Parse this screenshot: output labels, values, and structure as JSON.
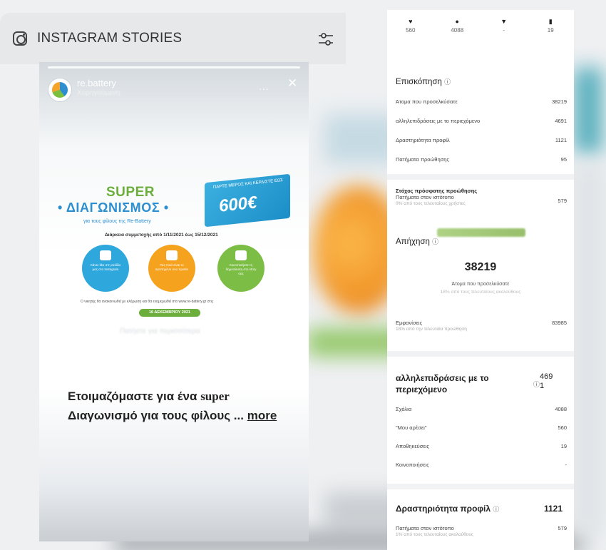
{
  "header": {
    "title": "INSTAGRAM STORIES"
  },
  "story": {
    "account_name": "re.battery",
    "account_sub": "Χορηγούμενη",
    "menu_dots": "...",
    "close": "✕",
    "promo": {
      "super": "SUPER",
      "title": "• ΔΙΑΓΩΝΙΣΜΟΣ •",
      "subtitle": "για τους φίλους της Re-Battery",
      "banner_top": "ΠΑΡΤΕ ΜΕΡΟΣ ΚΑΙ ΚΕΡΔΙΣΤΕ ΕΩΣ",
      "banner_amount": "600€",
      "dates": "Διάρκεια συμμετοχής από 1/11/2021 έως 15/12/2021",
      "step1": "Κάντε like στη σελίδα μας στο Instagram",
      "step2": "Πες ποιό είναι το αγαπημένο σου προϊόν",
      "step3": "Κοινοποιήστε τη δημοσίευση στο story σας",
      "fineprint": "Ο νικητής θα ανακοινωθεί με κλήρωση και θα ενημερωθεί στο www.re-battery.gr στις",
      "draw_date": "16 ΔΕΚΕΜΒΡΙΟΥ 2021",
      "faded_link": "Πατήστε για περισσότερα"
    },
    "caption_main": "Ετοιμαζόμαστε για ένα ",
    "caption_bold": "super",
    "caption_rest": " Διαγωνισμό για τους φίλους ... ",
    "caption_more": "more"
  },
  "insights": {
    "stats": [
      {
        "icon": "♥",
        "value": "560"
      },
      {
        "icon": "●",
        "value": "4088"
      },
      {
        "icon": "▼",
        "value": "-"
      },
      {
        "icon": "▮",
        "value": "19"
      }
    ],
    "overview_title": "Επισκόπηση",
    "overview_info": "ⓘ",
    "overview_rows": [
      {
        "label": "Άτομα που προσελκύσατε",
        "value": "38219"
      },
      {
        "label": "αλληλεπιδράσεις με το περιεχόμενο",
        "value": "4691"
      },
      {
        "label": "Δραστηριότητα προφίλ",
        "value": "1121"
      },
      {
        "label": "Πατήματα προώθησης",
        "value": "95"
      }
    ],
    "promo_goal_title": "Στόχος πρόσφατης προώθησης",
    "promo_goal_label": "Πατήματα στον ιστότοπο",
    "promo_goal_sub": "0% από τους τελευταίους χρήστες",
    "promo_goal_value": "579",
    "reach_title": "Απήχηση",
    "reach_info": "ⓘ",
    "reach_value": "38219",
    "reach_label": "Άτομα που προσελκύσατε",
    "reach_sub": "18% από τους τελευταίους ακολούθους",
    "impressions_label": "Εμφανίσεις",
    "impressions_sub": "18% από την τελευταία προώθηση",
    "impressions_value": "83985",
    "engagement_title": "αλληλεπιδράσεις με το περιεχόμενο",
    "engagement_info": "ⓘ",
    "engagement_value": "469 1",
    "engagement_rows": [
      {
        "label": "Σχόλια",
        "value": "4088"
      },
      {
        "label": "\"Μου αρέσει\"",
        "value": "560"
      },
      {
        "label": "Αποθηκεύσεις",
        "value": "19"
      },
      {
        "label": "Κοινοποιήσεις",
        "value": "-"
      }
    ],
    "profile_title": "Δραστηριότητα προφίλ",
    "profile_info": "ⓘ",
    "profile_value": "1121",
    "website_label": "Πατήματα στον ιστότοπο",
    "website_sub": "1% από τους τελευταίους ακολούθους",
    "website_value": "579"
  }
}
